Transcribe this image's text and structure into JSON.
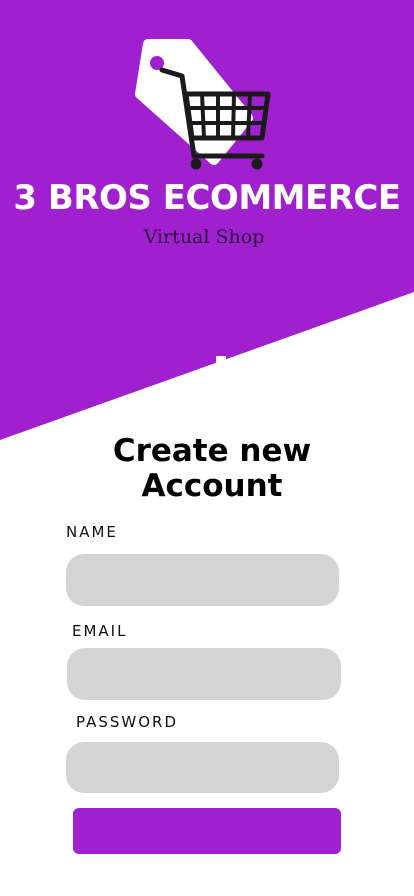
{
  "brand": {
    "title": "3 BROS ECOMMERCE",
    "subtitle": "Virtual Shop",
    "logo_icon": "shopping-cart-tag-icon"
  },
  "form": {
    "heading": "Create new Account",
    "fields": [
      {
        "label": "NAME",
        "value": "",
        "placeholder": ""
      },
      {
        "label": "EMAIL",
        "value": "",
        "placeholder": ""
      },
      {
        "label": "PASSWORD",
        "value": "",
        "placeholder": ""
      }
    ],
    "submit_label": ""
  },
  "colors": {
    "accent": "#a020d0",
    "input_background": "#d4d4d4",
    "background": "#ffffff"
  }
}
